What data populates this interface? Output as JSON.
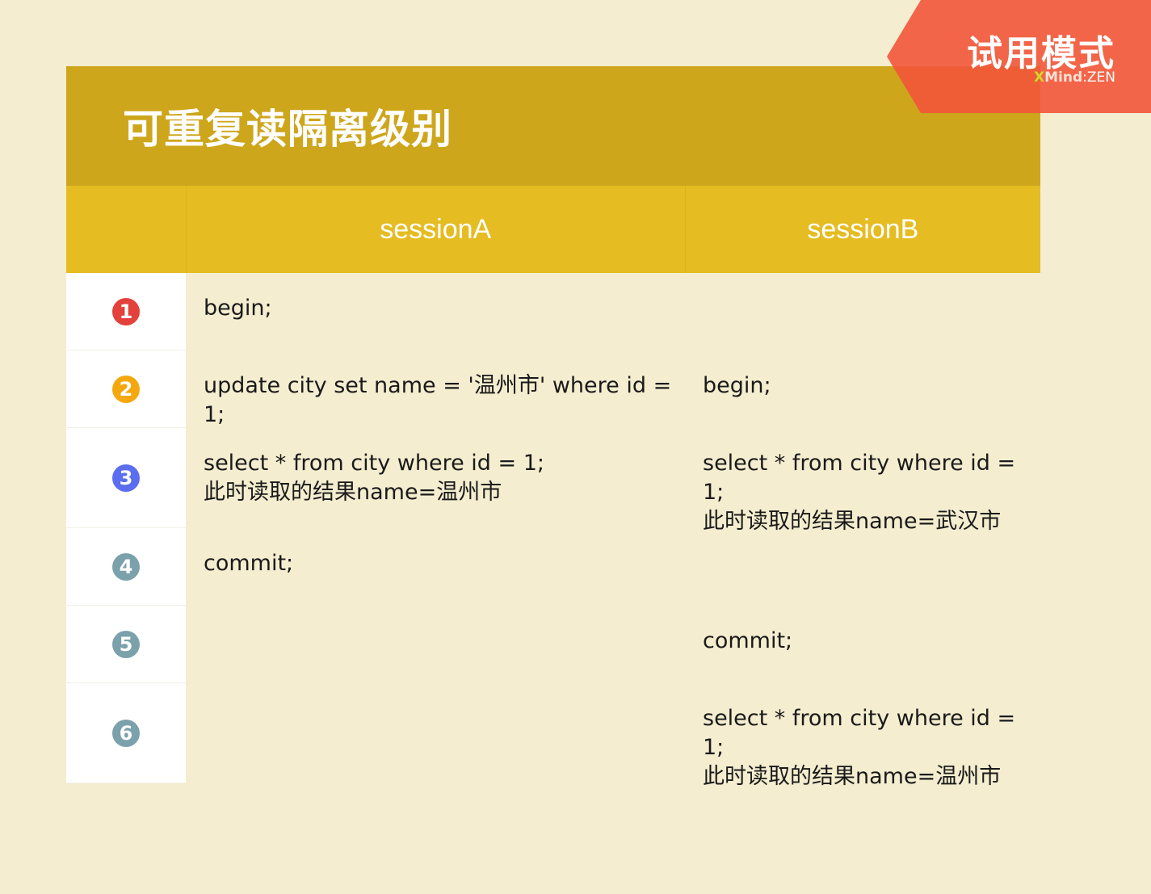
{
  "title": "可重复读隔离级别",
  "headers": {
    "col_a": "sessionA",
    "col_b": "sessionB"
  },
  "rows": [
    {
      "step": "1",
      "badge_color": "#e3413b",
      "a": "begin;",
      "b": ""
    },
    {
      "step": "2",
      "badge_color": "#f5a70e",
      "a": "update city set name = '温州市' where id = 1;",
      "b": "begin;"
    },
    {
      "step": "3",
      "badge_color": "#5b6ef0",
      "a": "select * from city where id = 1;\n此时读取的结果name=温州市",
      "b": "select * from city where id = 1;\n此时读取的结果name=武汉市"
    },
    {
      "step": "4",
      "badge_color": "#7ba1ab",
      "a": "commit;",
      "b": ""
    },
    {
      "step": "5",
      "badge_color": "#7ba1ab",
      "a": "",
      "b": "commit;"
    },
    {
      "step": "6",
      "badge_color": "#7ba1ab",
      "a": "",
      "b": "select * from city where id = 1;\n此时读取的结果name=温州市"
    }
  ],
  "watermark": {
    "label": "试用模式",
    "brand_x": "X",
    "brand_mind": "Mind",
    "brand_sep": ":",
    "brand_zen": "ZEN"
  },
  "colors": {
    "background": "#f4edcf",
    "title_bar": "#cda61c",
    "header_row": "#e5bc21",
    "watermark": "#f2553a"
  }
}
